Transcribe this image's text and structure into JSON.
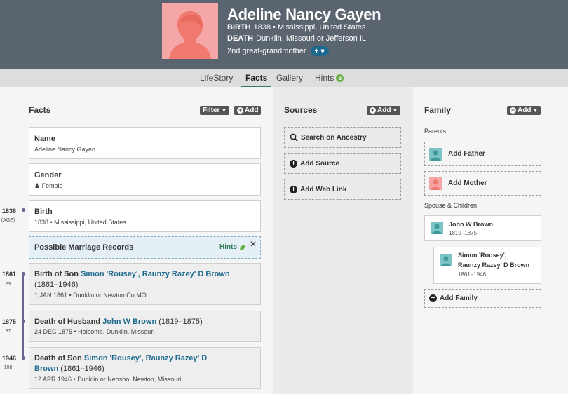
{
  "person": {
    "name": "Adeline Nancy Gayen",
    "birth_label": "BIRTH",
    "birth_value": "1838 • Mississippi, United States",
    "death_label": "DEATH",
    "death_value": "Dunklin, Missouri or Jefferson IL",
    "relationship": "2nd great-grandmother",
    "relationship_pill": "+ ♥"
  },
  "tabs": [
    {
      "label": "LifeStory"
    },
    {
      "label": "Facts",
      "active": true
    },
    {
      "label": "Gallery"
    },
    {
      "label": "Hints",
      "badge": "6"
    }
  ],
  "facts": {
    "title": "Facts",
    "filter_label": "Filter",
    "add_label": "Add",
    "name_card": {
      "title": "Name",
      "value": "Adeline Nancy Gayen"
    },
    "gender_card": {
      "title": "Gender",
      "value": "Female"
    },
    "birth_card": {
      "title": "Birth",
      "value": "1838 • Mississippi, United States"
    },
    "hints_card": {
      "title": "Possible Marriage Records",
      "link": "Hints",
      "close": "✕"
    },
    "events": [
      {
        "prefix": "Birth of Son ",
        "link": "Simon 'Rousey', Raunzy Razey' D Brown",
        "years": " (1861–1946)",
        "date": "1 JAN 1861 • Dunklin or Newton Co MO"
      },
      {
        "prefix": "Death of Husband ",
        "link": "John W Brown",
        "years": " (1819–1875)",
        "date": "24 DEC 1875 • Holcomb, Dunklin, Missouri"
      },
      {
        "prefix": "Death of Son ",
        "link": "Simon 'Rousey', Raunzy Razey' D Brown",
        "years": " (1861–1946)",
        "date": "12 APR 1946 • Dunklin or Neosho, Newton, Missouri"
      }
    ]
  },
  "timeline": [
    {
      "year": "1838",
      "age": "(AGE)"
    },
    {
      "year": "1861",
      "age": "23"
    },
    {
      "year": "1875",
      "age": "37"
    },
    {
      "year": "1946",
      "age": "108"
    }
  ],
  "sources": {
    "title": "Sources",
    "add_label": "Add",
    "search_label": "Search on Ancestry",
    "add_source_label": "Add Source",
    "add_weblink_label": "Add Web Link"
  },
  "family": {
    "title": "Family",
    "add_label": "Add",
    "parents_label": "Parents",
    "add_father": "Add Father",
    "add_mother": "Add Mother",
    "spouse_label": "Spouse & Children",
    "spouse": {
      "name": "John W Brown",
      "years": "1819–1875"
    },
    "child": {
      "name_line1": "Simon 'Rousey',",
      "name_line2": "Raunzy Razey' D Brown",
      "years": "1861–1946"
    },
    "add_family": "Add Family"
  },
  "colors": {
    "header_bg": "#5b6570",
    "female_avatar": "#f5a6a6",
    "male_avatar": "#7fc4c4",
    "link": "#1e6a8e",
    "timeline": "#6b6291",
    "hints_green": "#2f7d5b"
  }
}
